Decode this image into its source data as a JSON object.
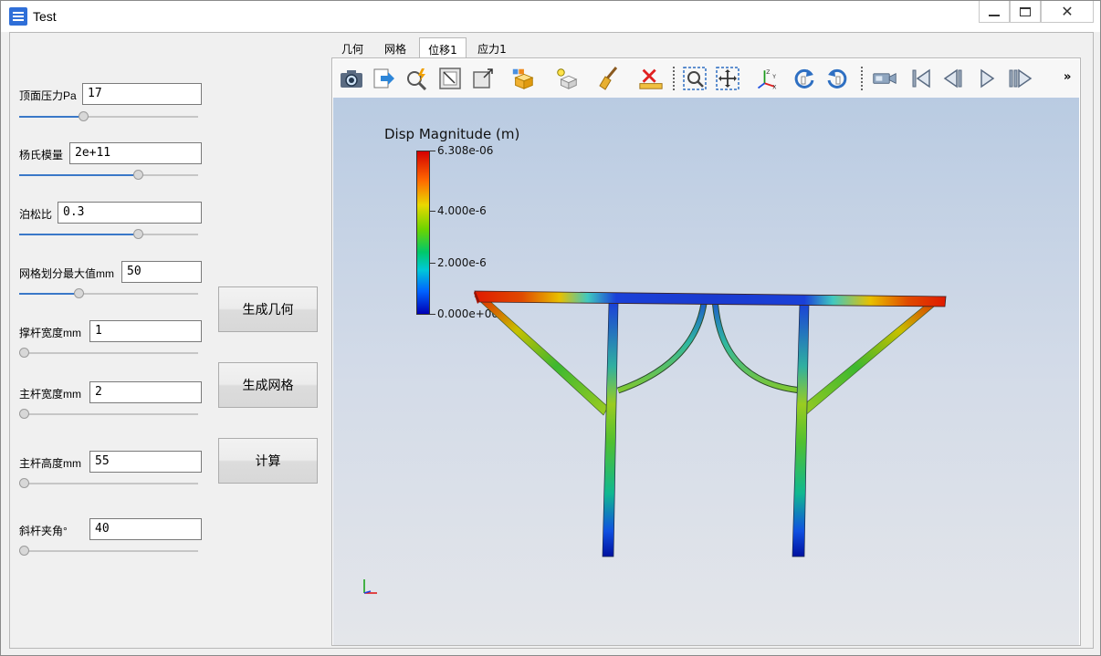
{
  "window": {
    "title": "Test"
  },
  "params": [
    {
      "label": "顶面压力Pa",
      "value": "17",
      "slider": 0.35
    },
    {
      "label": "杨氏模量",
      "value": "2e+11",
      "slider": 0.67
    },
    {
      "label": "泊松比",
      "value": "0.3",
      "slider": 0.67
    },
    {
      "label": "网格划分最大值mm",
      "value": "50",
      "slider": 0.32
    },
    {
      "label": "撑杆宽度mm",
      "value": "1",
      "slider": 0.0
    },
    {
      "label": "主杆宽度mm",
      "value": "2",
      "slider": 0.0
    },
    {
      "label": "主杆高度mm",
      "value": "55",
      "slider": 0.0
    },
    {
      "label": "斜杆夹角°",
      "value": "40",
      "slider": 0.0
    }
  ],
  "actions": {
    "gen_geometry": "生成几何",
    "gen_mesh": "生成网格",
    "compute": "计算"
  },
  "tabs": [
    "几何",
    "网格",
    "位移1",
    "应力1"
  ],
  "active_tab": "位移1",
  "toolbar_icons": [
    "camera-icon",
    "export-icon",
    "pick-icon",
    "reset-view-icon",
    "zoom-to-box-icon",
    "show-box-icon",
    "surface-icon",
    "light-icon",
    "brush-icon",
    "clear-icon",
    "ruler-icon",
    "zoom-select-icon",
    "pan-icon",
    "axes-icon",
    "rotate-cw-icon",
    "rotate-ccw-icon",
    "camera-record-icon",
    "first-frame-icon",
    "prev-frame-icon",
    "play-icon",
    "last-frame-icon"
  ],
  "toolbar_more": "»",
  "colorbar": {
    "title": "Disp Magnitude (m)",
    "max_label": "6.308e-06",
    "ticks": [
      "4.000e-6",
      "2.000e-6",
      "0.000e+00"
    ]
  },
  "colors": {
    "accent": "#3a78c8",
    "render_top": "#b9cbe2",
    "render_bottom": "#e4e6ea"
  }
}
